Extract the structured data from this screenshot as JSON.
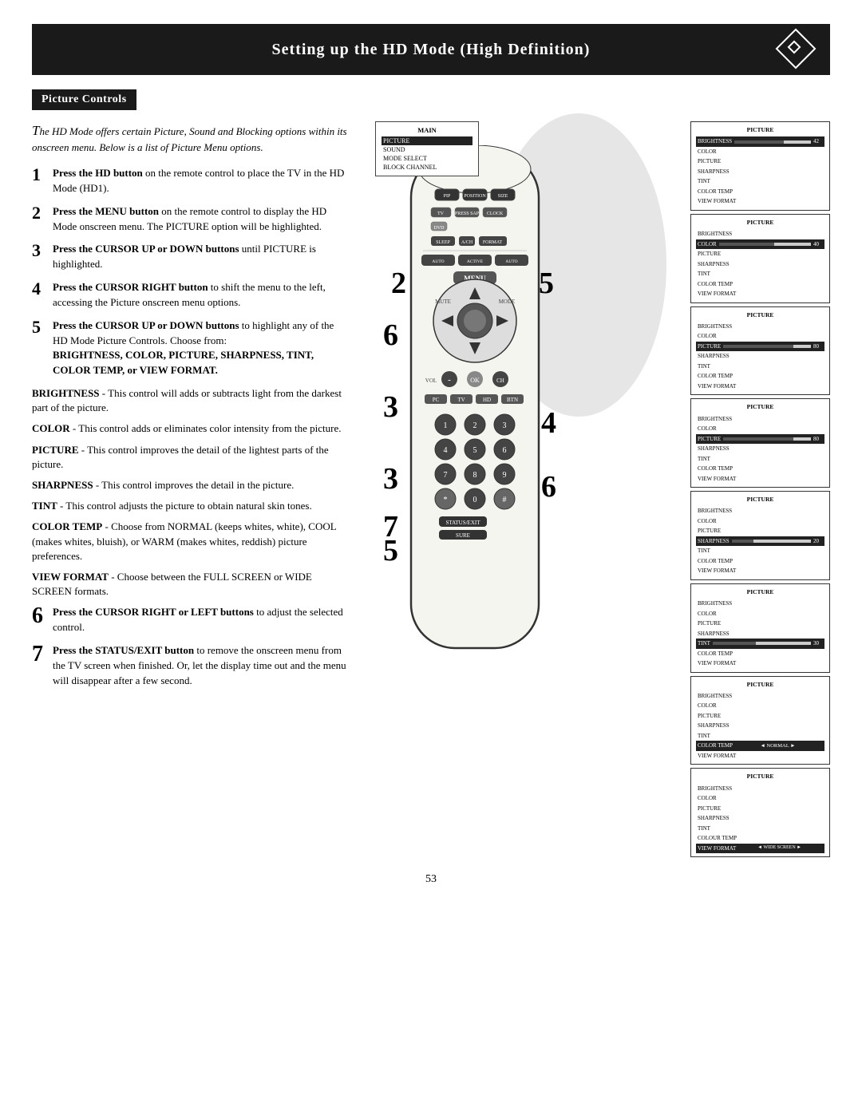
{
  "header": {
    "title": "Setting up the HD Mode (High Definition)"
  },
  "section": {
    "title": "Picture Controls"
  },
  "intro": {
    "text": "The HD Mode offers certain Picture, Sound and Blocking options within its onscreen menu. Below is a list of Picture Menu options."
  },
  "steps": [
    {
      "num": "1",
      "text": "Press the HD button on the remote control to place the TV in the HD Mode (HD1)."
    },
    {
      "num": "2",
      "text": "Press the MENU button on the remote control to display the HD Mode onscreen menu. The PICTURE option will be highlighted."
    },
    {
      "num": "3",
      "label": "Press the CURSOR UP or DOWN",
      "text": " buttons until PICTURE is highlighted."
    },
    {
      "num": "4",
      "label": "Press the CURSOR RIGHT button",
      "text": " to shift the menu to the left, accessing the Picture onscreen menu options."
    },
    {
      "num": "5",
      "label": "Press the CURSOR UP or DOWN",
      "text_intro": " buttons to highlight any of the HD Mode Picture Controls. Choose from: ",
      "highlight": "BRIGHTNESS, COLOR, PICTURE, SHARPNESS, TINT, COLOR TEMP, or VIEW FORMAT."
    }
  ],
  "controls": [
    {
      "name": "BRIGHTNESS",
      "desc": "This control will adds or subtracts light from the darkest part of the picture."
    },
    {
      "name": "COLOR",
      "desc": "This control adds or eliminates color intensity from the picture."
    },
    {
      "name": "PICTURE",
      "desc": "This control improves the detail of the lightest parts of the picture."
    },
    {
      "name": "SHARPNESS",
      "desc": "This control improves the detail in the picture."
    },
    {
      "name": "TINT",
      "desc": "This control adjusts the picture to obtain natural skin tones."
    },
    {
      "name": "COLOR TEMP",
      "desc": "Choose from NORMAL (keeps whites, white), COOL (makes whites, bluish), or WARM (makes whites, reddish) picture preferences."
    },
    {
      "name": "VIEW FORMAT",
      "desc": "Choose between the FULL SCREEN or WIDE SCREEN formats."
    }
  ],
  "steps_bottom": [
    {
      "num": "6",
      "label": "Press the CURSOR RIGHT or LEFT",
      "text": " buttons to adjust the selected control."
    },
    {
      "num": "7",
      "label": "Press the STATUS/EXIT button",
      "text": " to remove the onscreen menu from the TV screen when finished. Or, let the display time out and the menu will disappear after a few second."
    }
  ],
  "page_number": "53",
  "main_menu": {
    "title": "MAIN",
    "items": [
      "PICTURE",
      "SOUND",
      "MODE SELECT",
      "BLOCK CHANNEL"
    ],
    "highlighted": "PICTURE"
  },
  "screens": [
    {
      "title": "PICTURE",
      "items": [
        "BRIGHTNESS",
        "COLOR",
        "PICTURE",
        "SHARPNESS",
        "TINT",
        "COLOR TEMP",
        "VIEW FORMAT"
      ],
      "highlighted": "BRIGHTNESS",
      "slider_item": "BRIGHTNESS",
      "slider_val": 42,
      "slider_pct": 65
    },
    {
      "title": "PICTURE",
      "items": [
        "BRIGHTNESS",
        "COLOR",
        "PICTURE",
        "SHARPNESS",
        "TINT",
        "COLOR TEMP",
        "VIEW FORMAT"
      ],
      "highlighted": "COLOR",
      "slider_item": "COLOR",
      "slider_val": 40,
      "slider_pct": 62
    },
    {
      "title": "PICTURE",
      "items": [
        "BRIGHTNESS",
        "COLOR",
        "PICTURE",
        "SHARPNESS",
        "TINT",
        "COLOR TEMP",
        "VIEW FORMAT"
      ],
      "highlighted": "PICTURE",
      "slider_item": "PICTURE",
      "slider_val": 80,
      "slider_pct": 80
    },
    {
      "title": "PICTURE",
      "items": [
        "BRIGHTNESS",
        "COLOR",
        "PICTURE",
        "SHARPNESS",
        "TINT",
        "COLOR TEMP",
        "VIEW FORMAT"
      ],
      "highlighted": "PICTURE",
      "slider_item": "PICTURE",
      "slider_val": 80,
      "slider_pct": 80
    },
    {
      "title": "PICTURE",
      "items": [
        "BRIGHTNESS",
        "COLOR",
        "PICTURE",
        "SHARPNESS",
        "TINT",
        "COLOR TEMP",
        "VIEW FORMAT"
      ],
      "highlighted": "SHARPNESS",
      "slider_item": "SHARPNESS",
      "slider_val": 20,
      "slider_pct": 30
    },
    {
      "title": "PICTURE",
      "items": [
        "BRIGHTNESS",
        "COLOR",
        "PICTURE",
        "SHARPNESS",
        "TINT",
        "COLOR TEMP",
        "VIEW FORMAT"
      ],
      "highlighted": "TINT",
      "slider_item": "TINT",
      "slider_val": 30,
      "slider_pct": 45
    },
    {
      "title": "PICTURE",
      "items": [
        "BRIGHTNESS",
        "COLOR",
        "PICTURE",
        "SHARPNESS",
        "TINT",
        "COLOR TEMP",
        "VIEW FORMAT"
      ],
      "highlighted": "COLOR TEMP",
      "color_temp_val": "NORMAL"
    },
    {
      "title": "PICTURE",
      "items": [
        "BRIGHTNESS",
        "COLOR",
        "PICTURE",
        "SHARPNESS",
        "TINT",
        "COLOR TEMP",
        "VIEW FORMAT"
      ],
      "highlighted": "VIEW FORMAT",
      "view_format_val": "WIDE SCREEN"
    }
  ]
}
